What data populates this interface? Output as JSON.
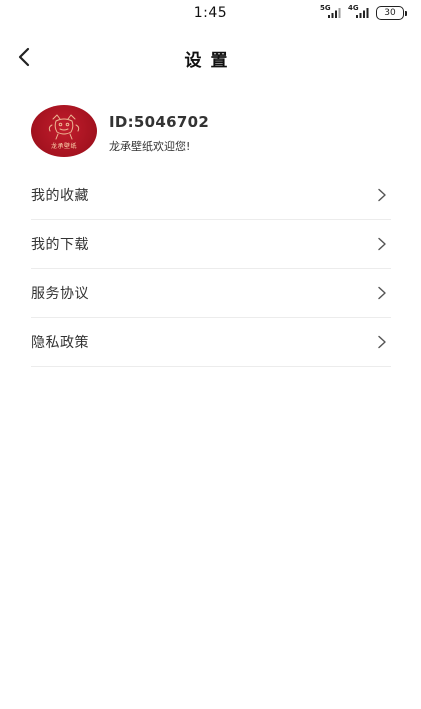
{
  "status_bar": {
    "time": "1:45",
    "network_1": "5G",
    "network_2": "4G",
    "battery": "30"
  },
  "header": {
    "title": "设置"
  },
  "profile": {
    "avatar_text": "龙承壁纸",
    "user_id": "ID:5046702",
    "welcome": "龙承壁纸欢迎您!"
  },
  "menu": {
    "items": [
      {
        "label": "我的收藏"
      },
      {
        "label": "我的下载"
      },
      {
        "label": "服务协议"
      },
      {
        "label": "隐私政策"
      }
    ]
  },
  "colors": {
    "avatar_red": "#a3121f",
    "divider": "#ececec"
  }
}
